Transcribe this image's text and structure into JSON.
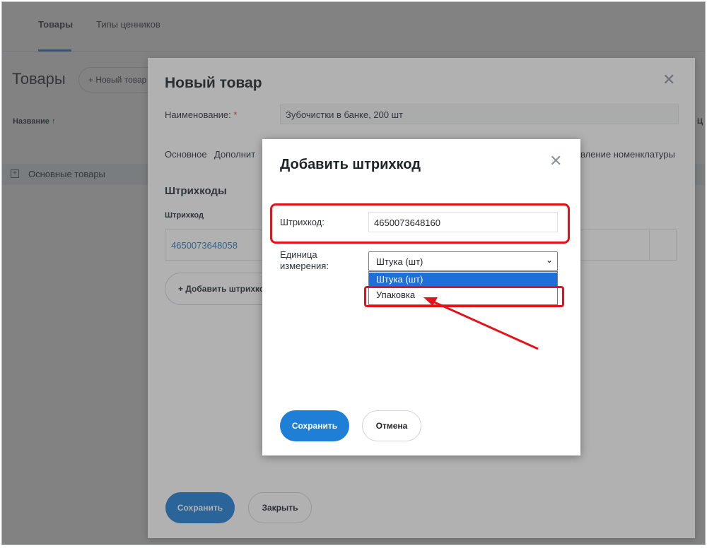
{
  "topnav": {
    "tab_products": "Товары",
    "tab_price_types": "Типы ценников"
  },
  "page": {
    "title": "Товары",
    "new_product_button": "+ Новый товар",
    "column_name": "Название ↑",
    "group_row": "Основные товары",
    "right_column_cut": "Ц"
  },
  "modal": {
    "title": "Новый товар",
    "close": "✕",
    "name_label": "Наименование:",
    "required_mark": "*",
    "name_value": "Зубочистки в банке, 200 шт",
    "tabs": [
      "Основное",
      "Дополнит"
    ],
    "tab_right": "вление номенклатуры",
    "section_barcodes": "Штрихкоды",
    "barcode_column": "Штрихкод",
    "barcode_value": "4650073648058",
    "add_barcode": "+  Добавить штрихкод",
    "save": "Сохранить",
    "close_button": "Закрыть"
  },
  "dialog": {
    "title": "Добавить штрихкод",
    "close": "✕",
    "barcode_label": "Штрихкод:",
    "barcode_value": "4650073648160",
    "unit_label": "Единица измерения:",
    "unit_selected": "Штука (шт)",
    "unit_options": [
      "Штука (шт)",
      "Упаковка"
    ],
    "save": "Сохранить",
    "cancel": "Отмена"
  },
  "colors": {
    "accent": "#1f7fd6",
    "annotation": "#e3131b",
    "selected_option": "#1e6fd9"
  }
}
